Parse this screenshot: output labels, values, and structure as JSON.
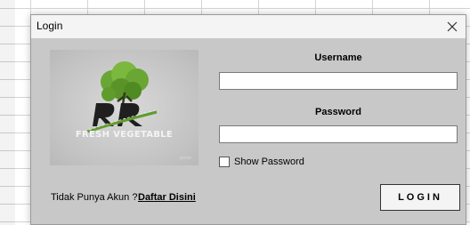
{
  "dialog": {
    "title": "Login",
    "close_icon": "close-icon"
  },
  "logo": {
    "brand_text": "FRESH VEGETABLE",
    "small_text": "sense"
  },
  "form": {
    "username_label": "Username",
    "username_value": "",
    "password_label": "Password",
    "password_value": "",
    "show_password_label": "Show Password",
    "show_password_checked": false
  },
  "footer": {
    "no_account_text": "Tidak Punya Akun ?",
    "register_link": "Daftar Disini",
    "login_button": "LOGIN"
  },
  "colors": {
    "dialog_bg": "#c8c8c8",
    "titlebar_bg": "#f4f4f4",
    "logo_green": "#5f9c2c",
    "logo_dark": "#1f1f1f"
  }
}
